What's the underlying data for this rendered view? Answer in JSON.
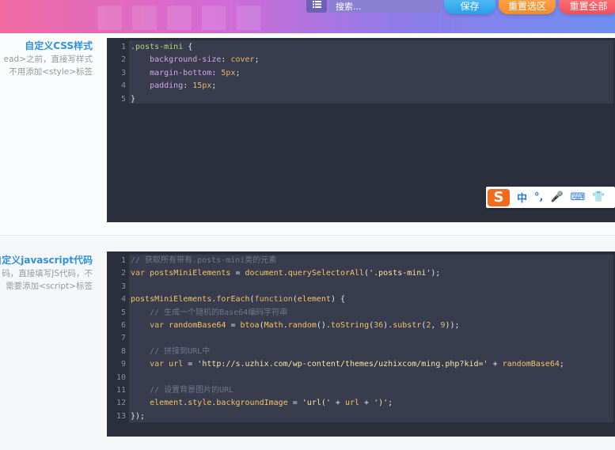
{
  "header": {
    "search_placeholder": "搜索...",
    "save_label": "保存",
    "reset_selection_label": "重置选区",
    "reset_all_label": "重置全部"
  },
  "options": [
    {
      "title": "自定义CSS样式",
      "desc_lines": [
        "ead>之前，直接写样式",
        "不用添加<style>标签"
      ],
      "editor_lang": "css"
    },
    {
      "title": "自定义javascript代码",
      "desc_lines": [
        "码，直接填写JS代码，不",
        "需要添加<script>标签"
      ],
      "editor_lang": "js"
    }
  ],
  "css_code": {
    "line_numbers": [
      "1",
      "2",
      "3",
      "4",
      "5"
    ],
    "lines": [
      [
        {
          "t": ".posts-mini",
          "c": "t-sel"
        },
        {
          "t": " {",
          "c": "t-p"
        }
      ],
      [
        {
          "t": "    background-size",
          "c": "t-prop"
        },
        {
          "t": ": ",
          "c": "t-p"
        },
        {
          "t": "cover",
          "c": "t-val"
        },
        {
          "t": ";",
          "c": "t-p"
        }
      ],
      [
        {
          "t": "    margin-bottom",
          "c": "t-prop"
        },
        {
          "t": ": ",
          "c": "t-p"
        },
        {
          "t": "5px",
          "c": "t-val"
        },
        {
          "t": ";",
          "c": "t-p"
        }
      ],
      [
        {
          "t": "    padding",
          "c": "t-prop"
        },
        {
          "t": ": ",
          "c": "t-p"
        },
        {
          "t": "15px",
          "c": "t-val"
        },
        {
          "t": ";",
          "c": "t-p"
        }
      ],
      [
        {
          "t": "}",
          "c": "t-p"
        }
      ]
    ]
  },
  "js_code": {
    "line_numbers": [
      "1",
      "2",
      "3",
      "4",
      "5",
      "6",
      "7",
      "8",
      "9",
      "10",
      "11",
      "12",
      "13"
    ],
    "lines": [
      [
        {
          "t": "// 获取所有带有.posts-mini类的元素",
          "c": "t-cm"
        }
      ],
      [
        {
          "t": "var ",
          "c": "t-kw"
        },
        {
          "t": "postsMiniElements",
          "c": "t-fn"
        },
        {
          "t": " = ",
          "c": "t-p"
        },
        {
          "t": "document",
          "c": "t-fn"
        },
        {
          "t": ".",
          "c": "t-p"
        },
        {
          "t": "querySelectorAll",
          "c": "t-fn"
        },
        {
          "t": "(",
          "c": "t-p"
        },
        {
          "t": "'.posts-mini'",
          "c": "t-str"
        },
        {
          "t": ");",
          "c": "t-p"
        }
      ],
      [],
      [
        {
          "t": "postsMiniElements",
          "c": "t-fn"
        },
        {
          "t": ".",
          "c": "t-p"
        },
        {
          "t": "forEach",
          "c": "t-fn"
        },
        {
          "t": "(",
          "c": "t-p"
        },
        {
          "t": "function",
          "c": "t-kw"
        },
        {
          "t": "(",
          "c": "t-p"
        },
        {
          "t": "element",
          "c": "t-fn"
        },
        {
          "t": ") {",
          "c": "t-p"
        }
      ],
      [
        {
          "t": "    // 生成一个随机的Base64编码字符串",
          "c": "t-cm"
        }
      ],
      [
        {
          "t": "    var ",
          "c": "t-kw"
        },
        {
          "t": "randomBase64",
          "c": "t-fn"
        },
        {
          "t": " = ",
          "c": "t-p"
        },
        {
          "t": "btoa",
          "c": "t-fn"
        },
        {
          "t": "(",
          "c": "t-p"
        },
        {
          "t": "Math",
          "c": "t-fn"
        },
        {
          "t": ".",
          "c": "t-p"
        },
        {
          "t": "random",
          "c": "t-fn"
        },
        {
          "t": "().",
          "c": "t-p"
        },
        {
          "t": "toString",
          "c": "t-fn"
        },
        {
          "t": "(",
          "c": "t-p"
        },
        {
          "t": "36",
          "c": "t-num"
        },
        {
          "t": ").",
          "c": "t-p"
        },
        {
          "t": "substr",
          "c": "t-fn"
        },
        {
          "t": "(",
          "c": "t-p"
        },
        {
          "t": "2",
          "c": "t-num"
        },
        {
          "t": ", ",
          "c": "t-p"
        },
        {
          "t": "9",
          "c": "t-num"
        },
        {
          "t": "));",
          "c": "t-p"
        }
      ],
      [],
      [
        {
          "t": "    // 拼接到URL中",
          "c": "t-cm"
        }
      ],
      [
        {
          "t": "    var ",
          "c": "t-kw"
        },
        {
          "t": "url",
          "c": "t-fn"
        },
        {
          "t": " = ",
          "c": "t-p"
        },
        {
          "t": "'http://s.uzhix.com/wp-content/themes/uzhixcom/ming.php?kid='",
          "c": "t-str"
        },
        {
          "t": " + ",
          "c": "t-p"
        },
        {
          "t": "randomBase64",
          "c": "t-fn"
        },
        {
          "t": ";",
          "c": "t-p"
        }
      ],
      [],
      [
        {
          "t": "    // 设置背景图片的URL",
          "c": "t-cm"
        }
      ],
      [
        {
          "t": "    element",
          "c": "t-fn"
        },
        {
          "t": ".",
          "c": "t-p"
        },
        {
          "t": "style",
          "c": "t-fn"
        },
        {
          "t": ".",
          "c": "t-p"
        },
        {
          "t": "backgroundImage",
          "c": "t-fn"
        },
        {
          "t": " = ",
          "c": "t-p"
        },
        {
          "t": "'url('",
          "c": "t-str"
        },
        {
          "t": " + ",
          "c": "t-p"
        },
        {
          "t": "url",
          "c": "t-fn"
        },
        {
          "t": " + ",
          "c": "t-p"
        },
        {
          "t": "')'",
          "c": "t-str"
        },
        {
          "t": ";",
          "c": "t-p"
        }
      ],
      [
        {
          "t": "});",
          "c": "t-p"
        }
      ]
    ]
  },
  "ime": {
    "logo": "S",
    "items": [
      "中",
      "°,",
      "🎤",
      "⌨",
      "👕"
    ]
  }
}
